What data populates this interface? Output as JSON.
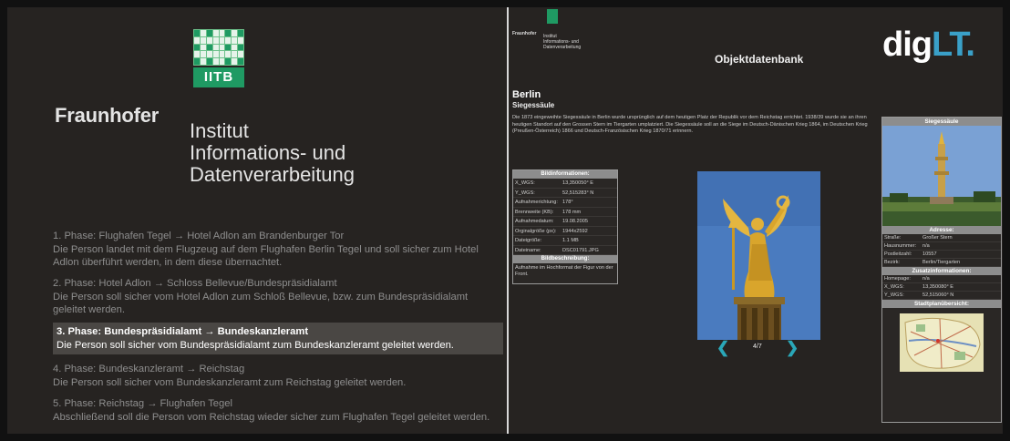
{
  "left": {
    "logo": "IITB",
    "org": "Fraunhofer",
    "institute_lines": [
      "Institut",
      "Informations- und",
      "Datenverarbeitung"
    ],
    "phases": [
      {
        "title": "1. Phase: Flughafen Tegel → Hotel Adlon am Brandenburger Tor",
        "text": "Die Person landet mit dem Flugzeug auf dem Flughafen Berlin Tegel und soll sicher zum Hotel Adlon überführt werden, in dem diese übernachtet.",
        "active": false
      },
      {
        "title": "2. Phase: Hotel Adlon → Schloss Bellevue/Bundespräsidialamt",
        "text": "Die Person soll sicher vom Hotel Adlon zum Schloß Bellevue, bzw. zum Bundespräsidialamt geleitet werden.",
        "active": false
      },
      {
        "title": "3. Phase: Bundespräsidialamt → Bundeskanzleramt",
        "text": "Die Person soll sicher vom Bundespräsidialamt zum Bundeskanzleramt geleitet werden.",
        "active": true
      },
      {
        "title": "4. Phase: Bundeskanzleramt → Reichstag",
        "text": "Die Person soll sicher vom Bundeskanzleramt zum Reichstag geleitet werden.",
        "active": false
      },
      {
        "title": "5. Phase: Reichstag → Flughafen Tegel",
        "text": "Abschließend soll die Person vom Reichstag wieder sicher zum Flughafen Tegel geleitet werden.",
        "active": false
      }
    ]
  },
  "right": {
    "fh_name": "Fraunhofer",
    "fh_inst_lines": [
      "Institut",
      "Informations- und",
      "Datenverarbeitung"
    ],
    "title": "Objektdatenbank",
    "brand_a": "dig",
    "brand_b": "LT.",
    "city": "Berlin",
    "object": "Siegessäule",
    "description": "Die 1873 eingeweihte Siegessäule in Berlin wurde ursprünglich auf dem heutigen Platz der Republik vor dem Reichstag errichtet. 1938/39 wurde sie an ihren heutigen Standort auf den Grossen Stern im Tiergarten umplatziert. Die Siegessäule soll an die Siege im Deutsch-Dänischen Krieg 1864, im Deutschen Krieg (Preußen-Österreich) 1866 und Deutsch-Französischen Krieg 1870/71 erinnern.",
    "bildinfo_header": "Bildinformationen:",
    "bildinfo": [
      {
        "k": "X_WGS:",
        "v": "13,350050° E"
      },
      {
        "k": "Y_WGS:",
        "v": "52,515283° N"
      },
      {
        "k": "Aufnahmerichtung:",
        "v": "178°"
      },
      {
        "k": "Brennweite (KB):",
        "v": "178 mm"
      },
      {
        "k": "Aufnahmedatum:",
        "v": "19.08.2005"
      },
      {
        "k": "Orginalgröße (px):",
        "v": "1944x2592"
      },
      {
        "k": "Dateigröße:",
        "v": "1.1 MB"
      },
      {
        "k": "Dateiname:",
        "v": "DSC01791.JPG"
      }
    ],
    "bildbeschr_header": "Bildbeschreibung:",
    "bildbeschr": "Aufnahme im Hochformat der Figur von der Front.",
    "pager": "4/7",
    "prev": "❮",
    "next": "❯",
    "side_title": "Siegessäule",
    "adresse_header": "Adresse:",
    "adresse": [
      {
        "k": "Straße:",
        "v": "Großer Stern"
      },
      {
        "k": "Hausnummer:",
        "v": "n/a"
      },
      {
        "k": "Postleitzahl:",
        "v": "10557"
      },
      {
        "k": "Bezirk:",
        "v": "Berlin/Tiergarten"
      }
    ],
    "zusatz_header": "Zusatzinformationen:",
    "zusatz": [
      {
        "k": "Homepage:",
        "v": "n/a"
      },
      {
        "k": "X_WGS:",
        "v": "13,350080° E"
      },
      {
        "k": "Y_WGS:",
        "v": "52,515060° N"
      }
    ],
    "stadtplan_header": "Stadtplanübersicht:"
  }
}
